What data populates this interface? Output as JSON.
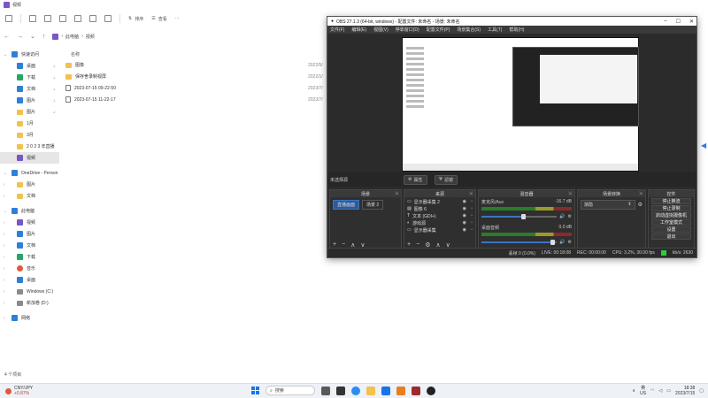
{
  "explorer": {
    "title": "视频",
    "toolbar": {
      "sort_label": "排序",
      "view_label": "查看"
    },
    "breadcrumb": [
      "此电脑",
      "视频"
    ],
    "column_name": "名称",
    "files": [
      {
        "name": "图像",
        "date": "2022/5/",
        "type": "folder"
      },
      {
        "name": "保存舍录制视屏",
        "date": "2022/1/",
        "type": "folder"
      },
      {
        "name": "2023-07-15 09-22-50",
        "date": "2023/7/",
        "type": "file"
      },
      {
        "name": "2023-07-15 11-22-17",
        "date": "2023/7/",
        "type": "file"
      }
    ],
    "sidebar": [
      {
        "label": "快速访问",
        "icon": "star-icon",
        "chev": "⌄"
      },
      {
        "label": "桌面",
        "icon": "desktop-icon",
        "pin": true
      },
      {
        "label": "下载",
        "icon": "download-icon",
        "pin": true
      },
      {
        "label": "文档",
        "icon": "document-icon",
        "pin": true
      },
      {
        "label": "图片",
        "icon": "pictures-icon",
        "pin": true
      },
      {
        "label": "图片",
        "icon": "folder-icon",
        "pin": true
      },
      {
        "label": "1月",
        "icon": "folder-icon"
      },
      {
        "label": "3月",
        "icon": "folder-icon"
      },
      {
        "label": "2 0 2 3 年直播",
        "icon": "folder-icon"
      },
      {
        "label": "视频",
        "icon": "videos-icon",
        "selected": true
      },
      {
        "label": "OneDrive - Person",
        "icon": "onedrive-icon",
        "chev": "⌄"
      },
      {
        "label": "图片",
        "icon": "folder-icon",
        "chev": "›"
      },
      {
        "label": "文档",
        "icon": "folder-icon",
        "chev": "›"
      },
      {
        "label": "此电脑",
        "icon": "pc-icon",
        "chev": "⌄"
      },
      {
        "label": "视频",
        "icon": "videos-icon",
        "chev": "›"
      },
      {
        "label": "图片",
        "icon": "pictures-icon",
        "chev": "›"
      },
      {
        "label": "文档",
        "icon": "document-icon",
        "chev": "›"
      },
      {
        "label": "下载",
        "icon": "download-icon",
        "chev": "›"
      },
      {
        "label": "音乐",
        "icon": "music-icon",
        "chev": "›"
      },
      {
        "label": "桌面",
        "icon": "desktop-icon",
        "chev": "›"
      },
      {
        "label": "Windows (C:)",
        "icon": "drive-icon",
        "chev": "›"
      },
      {
        "label": "新加卷 (D:)",
        "icon": "drive-icon",
        "chev": "›"
      },
      {
        "label": "网络",
        "icon": "network-icon",
        "chev": "›"
      }
    ],
    "status": "4 个项目"
  },
  "obs": {
    "title": "OBS 27.1.3 (64-bit, windows) - 配置文件: 未命名 - 场景: 未命名",
    "menu": [
      "文件(F)",
      "编辑(E)",
      "视图(V)",
      "停靠窗口(D)",
      "配置文件(P)",
      "场景集合(S)",
      "工具(T)",
      "帮助(H)"
    ],
    "no_source": "未选择源",
    "props_label": "属性",
    "filters_label": "滤镜",
    "docks": {
      "scenes": "场景",
      "sources": "来源",
      "mixer": "混音器",
      "transitions": "场景转换",
      "controls": "控件"
    },
    "scenes": [
      "直播画面",
      "场景 2"
    ],
    "sources": [
      "显示器采集 2",
      "图像 6",
      "文本 (GDI+)",
      "游戏源",
      "显示器采集"
    ],
    "mixer": [
      {
        "name": "麦克风/Aux",
        "db": "-16.7 dB"
      },
      {
        "name": "桌面音频",
        "db": "0.0 dB"
      }
    ],
    "transition": "渐隐",
    "controls": [
      "停止推流",
      "停止录制",
      "启动虚拟摄像机",
      "工作室模式",
      "设置",
      "退出"
    ],
    "status": {
      "dropped": "丢帧 0 (0.0%)",
      "live": "LIVE: 00:18:08",
      "rec": "REC: 00:00:00",
      "cpu": "CPU: 3.2%, 30.00 fps",
      "kbps": "kb/s: 2630"
    }
  },
  "taskbar": {
    "stock_name": "CNY/JPY",
    "stock_change": "+0.87%",
    "search_label": "搜索",
    "lang_top": "英",
    "lang_bottom": "US",
    "time": "18:38",
    "date": "2023/7/15"
  }
}
